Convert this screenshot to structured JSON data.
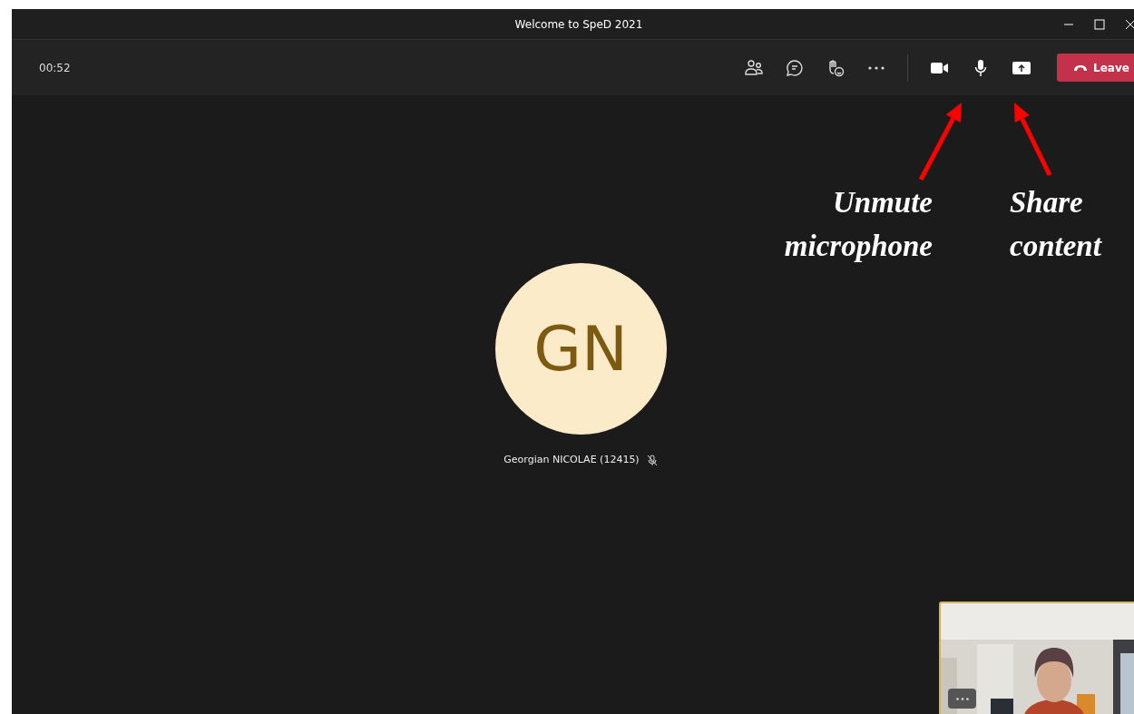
{
  "window": {
    "title": "Welcome to SpeD 2021"
  },
  "toolbar": {
    "timer": "00:52",
    "buttons": [
      {
        "kind": "people"
      },
      {
        "kind": "chat"
      },
      {
        "kind": "reactions"
      },
      {
        "kind": "more"
      },
      {
        "kind": "divider"
      },
      {
        "kind": "camera"
      },
      {
        "kind": "microphone"
      },
      {
        "kind": "share"
      }
    ],
    "leave_button": "Leave"
  },
  "participant": {
    "initials": "GN",
    "name": "Georgian NICOLAE (12415)",
    "muted": true
  },
  "annotations": [
    {
      "text": "Unmute microphone"
    },
    {
      "text": "Share content"
    }
  ]
}
